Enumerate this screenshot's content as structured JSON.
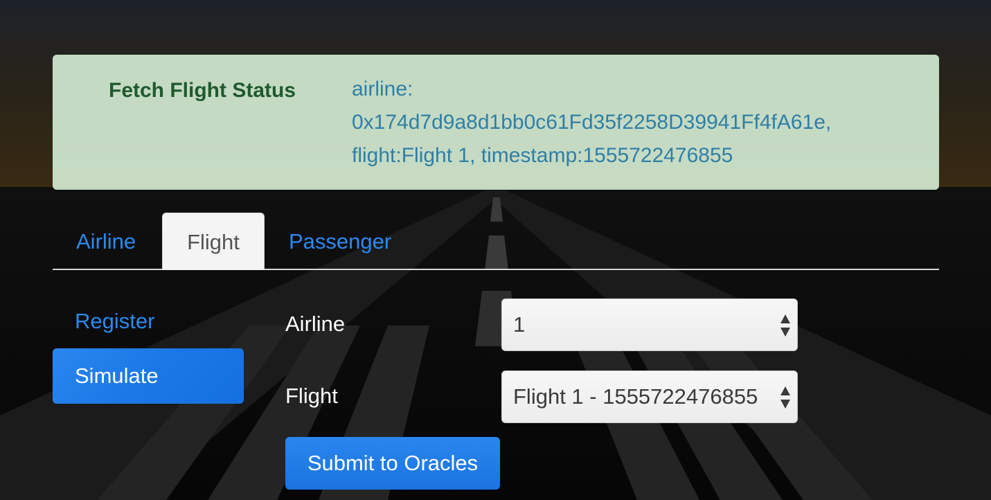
{
  "status": {
    "label": "Fetch Flight Status",
    "value_lines": [
      "airline:",
      "0x174d7d9a8d1bb0c61Fd35f2258D39941Ff4fA61e,",
      "flight:Flight 1, timestamp:1555722476855"
    ]
  },
  "tabs": [
    {
      "label": "Airline",
      "active": false
    },
    {
      "label": "Flight",
      "active": true
    },
    {
      "label": "Passenger",
      "active": false
    }
  ],
  "side_nav": [
    {
      "label": "Register",
      "active": false
    },
    {
      "label": "Simulate",
      "active": true
    }
  ],
  "form": {
    "airline_label": "Airline",
    "airline_value": "1",
    "flight_label": "Flight",
    "flight_value": "Flight 1 - 1555722476855",
    "submit_label": "Submit to Oracles"
  },
  "colors": {
    "link": "#2a8af0",
    "primary": "#1a78e6",
    "status_bg": "#d6eed6",
    "status_label": "#1f5a2e",
    "status_text": "#2f7fa6"
  },
  "icons": {
    "select_arrows": "updown-arrows-icon"
  }
}
